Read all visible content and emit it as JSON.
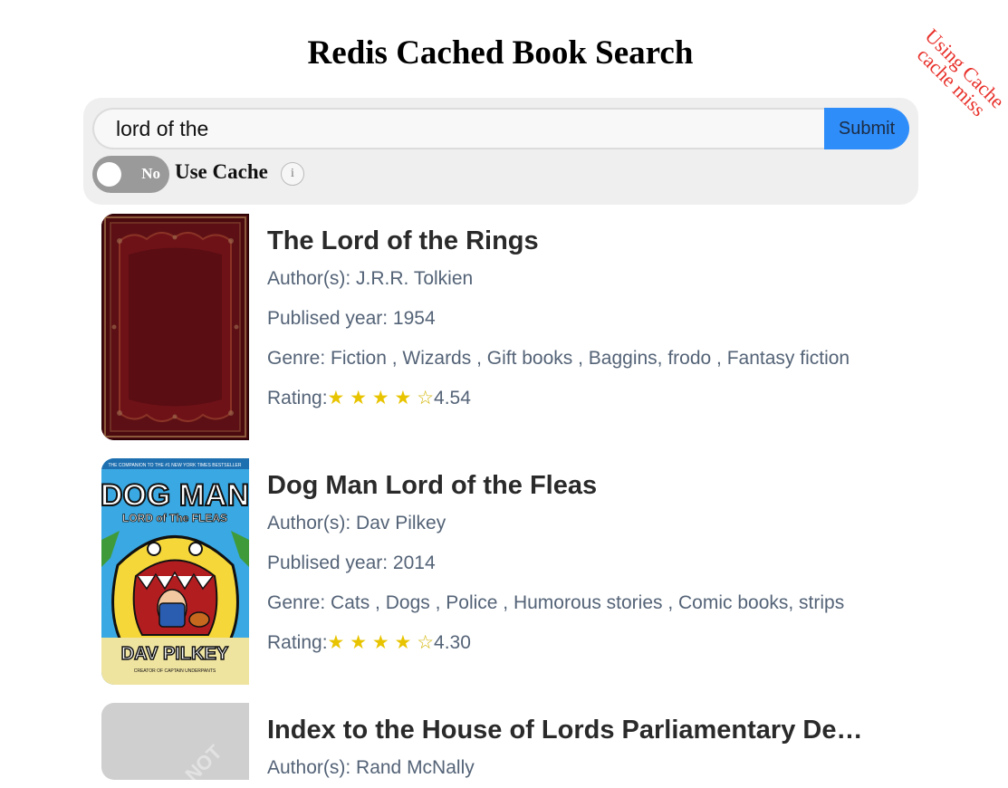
{
  "header": {
    "title": "Redis Cached Book Search"
  },
  "ribbon": {
    "line1": "Using Cache",
    "line2": "cache miss"
  },
  "search": {
    "value": "lord of the",
    "submit_label": "Submit"
  },
  "cache": {
    "toggle_state": "No",
    "label": "Use Cache",
    "info_glyph": "i"
  },
  "labels": {
    "authors": "Author(s): ",
    "year": "Publised year: ",
    "genre": "Genre: ",
    "rating": "Rating:"
  },
  "books": [
    {
      "title": "The Lord of the Rings",
      "authors": "J.R.R. Tolkien",
      "year": "1954",
      "genre": "Fiction , Wizards , Gift books , Baggins, frodo , Fantasy fiction",
      "stars": "★ ★ ★ ★ ",
      "half_star": "☆",
      "rating": "4.54"
    },
    {
      "title": "Dog Man Lord of the Fleas",
      "authors": "Dav Pilkey",
      "year": "2014",
      "genre": "Cats , Dogs , Police , Humorous stories , Comic books, strips",
      "stars": "★ ★ ★ ★ ",
      "half_star": "☆",
      "rating": "4.30"
    },
    {
      "title": "Index to the House of Lords Parliamentary Debates",
      "authors": "Rand McNally"
    }
  ],
  "covers": {
    "book1": {
      "base_color": "#5a0d12",
      "accent_color": "#8a2a22",
      "gold": "#b08850"
    },
    "book2": {
      "title_text": "DOG MAN",
      "subtitle_text": "LORD of The FLEAS",
      "author_text": "DAV PILKEY",
      "top_text": "THE COMPANION TO THE #1 NEW YORK TIMES BESTSELLER",
      "bottom_text": "CREATOR OF CAPTAIN UNDERPANTS",
      "sky_color": "#3aa8e2",
      "face_color": "#f6d73a"
    },
    "book3": {
      "placeholder_color": "#cfcfcf",
      "watermark_text": "NOT"
    }
  }
}
